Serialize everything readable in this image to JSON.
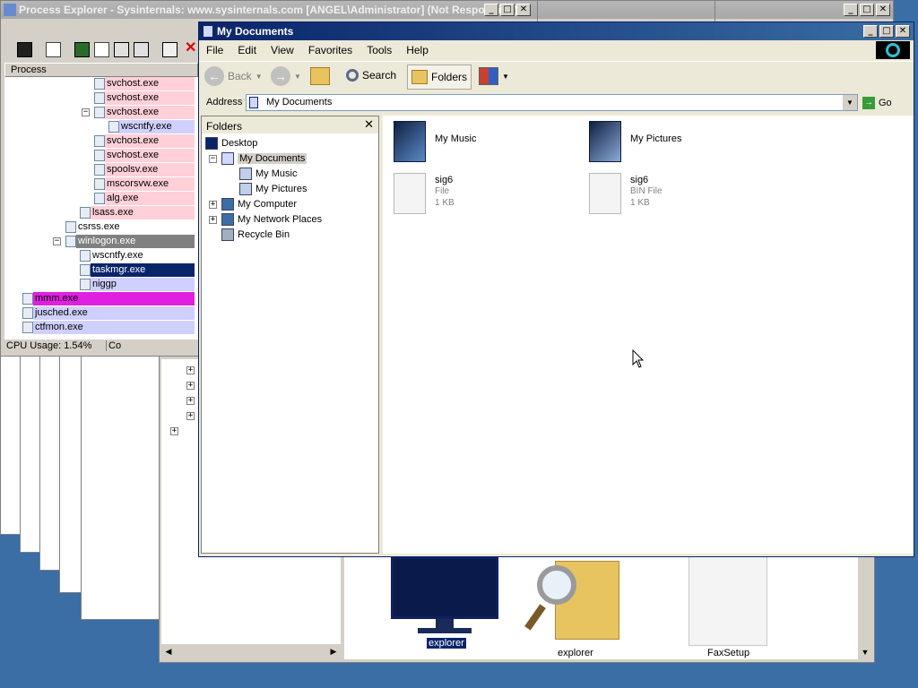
{
  "process_explorer": {
    "title": "Process Explorer - Sysinternals: www.sysinternals.com [ANGEL\\Administrator] (Not Responding)",
    "column_process": "Process",
    "processes": [
      {
        "name": "svchost.exe",
        "bg": "#ffd0d8"
      },
      {
        "name": "svchost.exe",
        "bg": "#ffd0d8"
      },
      {
        "name": "svchost.exe",
        "bg": "#ffd0d8"
      },
      {
        "name": "wscntfy.exe",
        "bg": "#d0d0ff"
      },
      {
        "name": "svchost.exe",
        "bg": "#ffd0d8"
      },
      {
        "name": "svchost.exe",
        "bg": "#ffd0d8"
      },
      {
        "name": "spoolsv.exe",
        "bg": "#ffd0d8"
      },
      {
        "name": "mscorsvw.exe",
        "bg": "#ffd0d8"
      },
      {
        "name": "alg.exe",
        "bg": "#ffd0d8"
      },
      {
        "name": "lsass.exe",
        "bg": "#ffd0d8"
      },
      {
        "name": "csrss.exe",
        "bg": "#ffffff"
      },
      {
        "name": "winlogon.exe",
        "bg": "#808080"
      },
      {
        "name": "wscntfy.exe",
        "bg": "#ffffff"
      },
      {
        "name": "taskmgr.exe",
        "bg": "#0a246a"
      },
      {
        "name": "niggp",
        "bg": "#d0d0ff"
      },
      {
        "name": "mmm.exe",
        "bg": "#e020e0"
      },
      {
        "name": "jusched.exe",
        "bg": "#d0d0ff"
      },
      {
        "name": "ctfmon.exe",
        "bg": "#d0d0ff"
      }
    ],
    "status_cpu": "CPU Usage: 1.54%",
    "status_commit": "Co"
  },
  "background_windows": {
    "folder_items": [
      {
        "label": "explorer",
        "icon": "monitor-icon"
      },
      {
        "label": "explorer",
        "icon": "search-folder-icon"
      },
      {
        "label": "FaxSetup",
        "icon": "file-icon"
      }
    ]
  },
  "explorer": {
    "title": "My Documents",
    "menu": [
      "File",
      "Edit",
      "View",
      "Favorites",
      "Tools",
      "Help"
    ],
    "toolbar": {
      "back": "Back",
      "search": "Search",
      "folders": "Folders"
    },
    "address": {
      "label": "Address",
      "value": "My Documents",
      "go": "Go"
    },
    "folders_pane": {
      "title": "Folders",
      "items": [
        {
          "label": "Desktop",
          "indent": 0,
          "expander": ""
        },
        {
          "label": "My Documents",
          "indent": 1,
          "expander": "−",
          "selected": true
        },
        {
          "label": "My Music",
          "indent": 2,
          "expander": ""
        },
        {
          "label": "My Pictures",
          "indent": 2,
          "expander": ""
        },
        {
          "label": "My Computer",
          "indent": 1,
          "expander": "+"
        },
        {
          "label": "My Network Places",
          "indent": 1,
          "expander": "+"
        },
        {
          "label": "Recycle Bin",
          "indent": 1,
          "expander": ""
        }
      ]
    },
    "content": [
      {
        "name": "My Music",
        "type": "",
        "size": "",
        "icon": "music-folder-icon"
      },
      {
        "name": "My Pictures",
        "type": "",
        "size": "",
        "icon": "pictures-folder-icon"
      },
      {
        "name": "sig6",
        "type": "File",
        "size": "1 KB",
        "icon": "file-icon"
      },
      {
        "name": "sig6",
        "type": "BIN File",
        "size": "1 KB",
        "icon": "file-icon"
      }
    ]
  }
}
